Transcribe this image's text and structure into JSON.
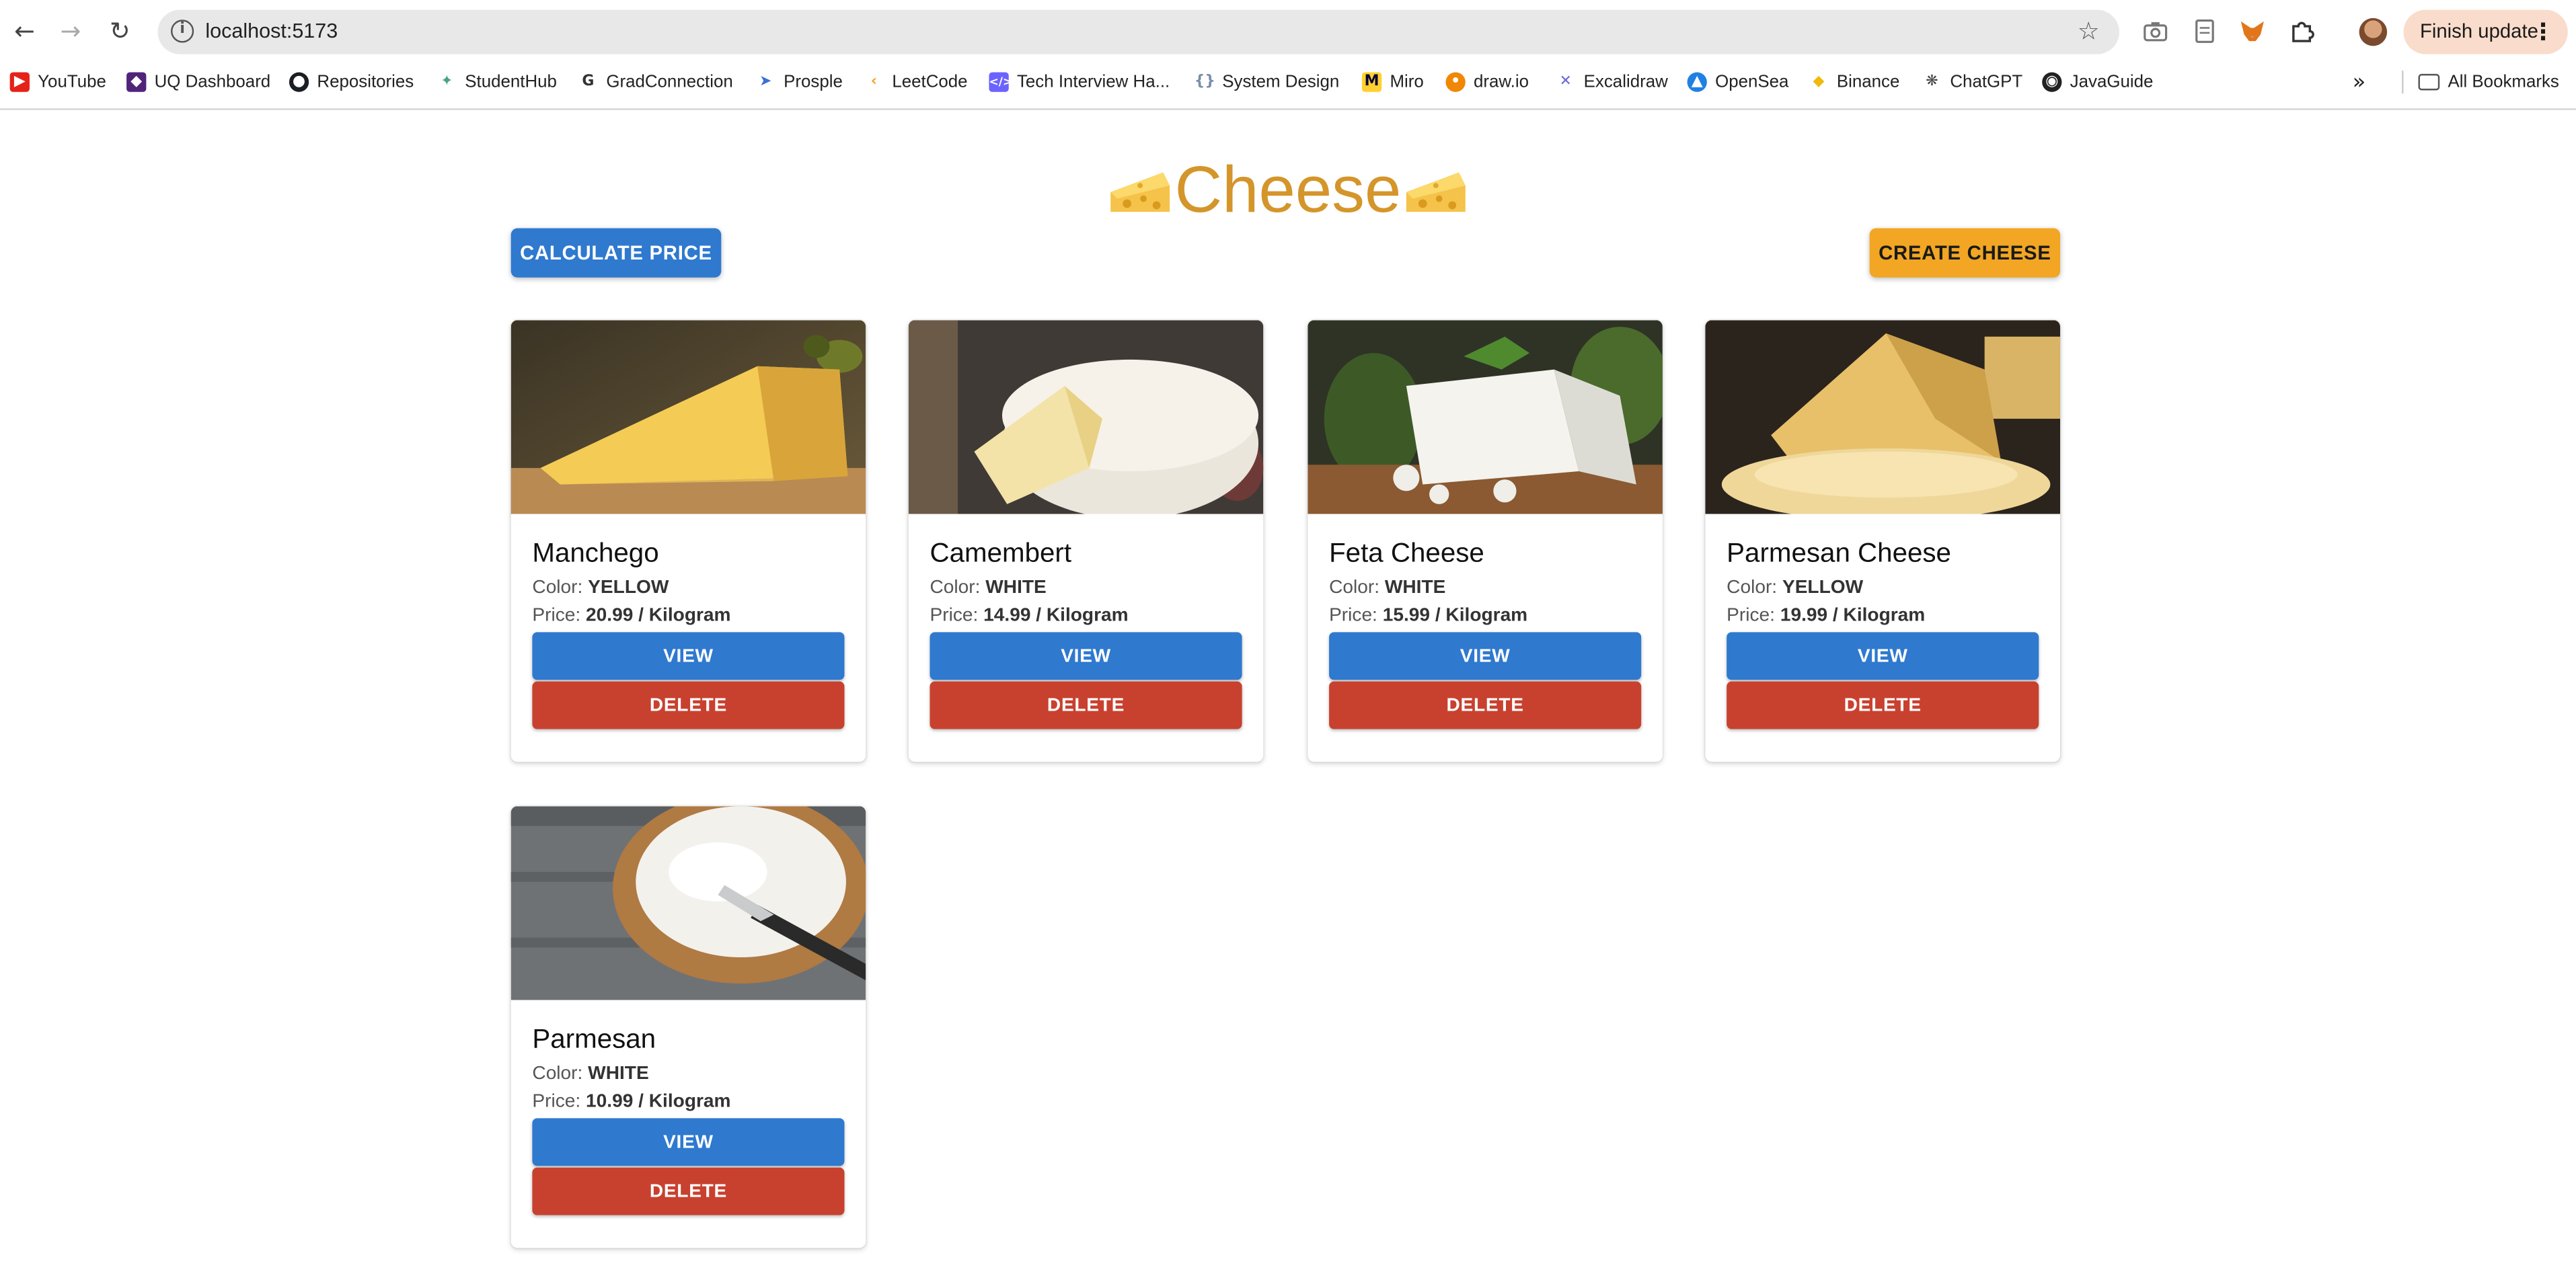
{
  "browser": {
    "url": "localhost:5173",
    "finish_update_label": "Finish update",
    "bookmarks": [
      {
        "label": "YouTube",
        "icon": "youtube-icon",
        "color": "#e62117"
      },
      {
        "label": "UQ Dashboard",
        "icon": "shield-icon",
        "color": "#51247a"
      },
      {
        "label": "Repositories",
        "icon": "github-icon",
        "color": "#1b1f23"
      },
      {
        "label": "StudentHub",
        "icon": "studenthub-icon",
        "color": "#4aa37c"
      },
      {
        "label": "GradConnection",
        "icon": "gradconnection-icon",
        "color": "#333333"
      },
      {
        "label": "Prosple",
        "icon": "rocket-icon",
        "color": "#3b6fd8"
      },
      {
        "label": "LeetCode",
        "icon": "leetcode-icon",
        "color": "#f89f1b"
      },
      {
        "label": "Tech Interview Ha...",
        "icon": "code-icon",
        "color": "#6c63ff"
      },
      {
        "label": "System Design",
        "icon": "braces-icon",
        "color": "#7a8ea8"
      },
      {
        "label": "Miro",
        "icon": "miro-icon",
        "color": "#ffd02f"
      },
      {
        "label": "draw.io",
        "icon": "drawio-icon",
        "color": "#f08705"
      },
      {
        "label": "Excalidraw",
        "icon": "excalidraw-icon",
        "color": "#6965db"
      },
      {
        "label": "OpenSea",
        "icon": "opensea-icon",
        "color": "#2081e2"
      },
      {
        "label": "Binance",
        "icon": "binance-icon",
        "color": "#f0b90b"
      },
      {
        "label": "ChatGPT",
        "icon": "chatgpt-icon",
        "color": "#444444"
      },
      {
        "label": "JavaGuide",
        "icon": "globe-icon",
        "color": "#222222"
      }
    ],
    "all_bookmarks_label": "All Bookmarks"
  },
  "page": {
    "title": "Cheese",
    "calculate_label": "CALCULATE PRICE",
    "create_label": "CREATE CHEESE",
    "accent_yellow": "#f2a623",
    "accent_blue": "#2f79cf",
    "accent_red": "#c8412f"
  },
  "cheeses": [
    {
      "name": "Manchego",
      "color_label": "Color:",
      "color": "YELLOW",
      "price_label": "Price:",
      "price": "20.99 / Kilogram",
      "view_label": "VIEW",
      "delete_label": "DELETE",
      "photo": "manchego-photo"
    },
    {
      "name": "Camembert",
      "color_label": "Color:",
      "color": "WHITE",
      "price_label": "Price:",
      "price": "14.99 / Kilogram",
      "view_label": "VIEW",
      "delete_label": "DELETE",
      "photo": "camembert-photo"
    },
    {
      "name": "Feta Cheese",
      "color_label": "Color:",
      "color": "WHITE",
      "price_label": "Price:",
      "price": "15.99 / Kilogram",
      "view_label": "VIEW",
      "delete_label": "DELETE",
      "photo": "feta-photo"
    },
    {
      "name": "Parmesan Cheese",
      "color_label": "Color:",
      "color": "YELLOW",
      "price_label": "Price:",
      "price": "19.99 / Kilogram",
      "view_label": "VIEW",
      "delete_label": "DELETE",
      "photo": "parmesan-cheese-photo"
    },
    {
      "name": "Parmesan",
      "color_label": "Color:",
      "color": "WHITE",
      "price_label": "Price:",
      "price": "10.99 / Kilogram",
      "view_label": "VIEW",
      "delete_label": "DELETE",
      "photo": "ricotta-photo"
    }
  ]
}
